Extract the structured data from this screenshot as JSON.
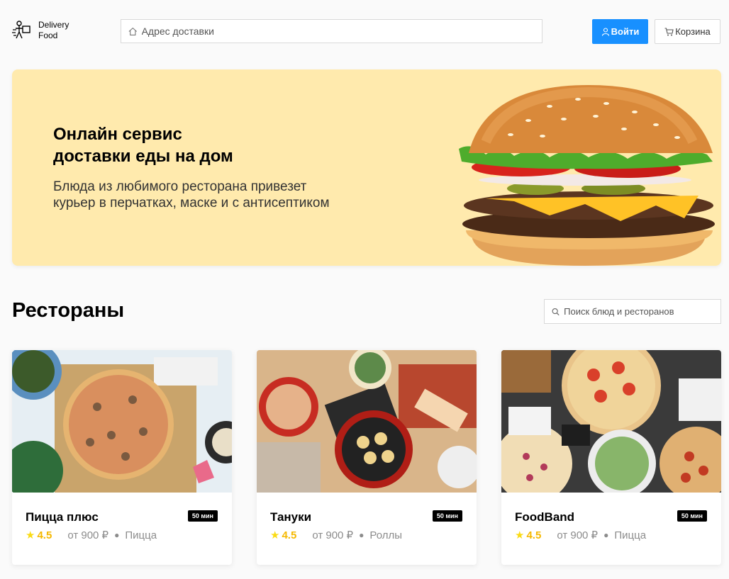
{
  "header": {
    "logo_line1": "Delivery",
    "logo_line2": "Food",
    "address_placeholder": "Адрес доставки",
    "login_label": "Войти",
    "cart_label": "Корзина",
    "accent_color": "#1890ff"
  },
  "promo": {
    "title": "Онлайн сервис\nдоставки еды на дом",
    "text": "Блюда из любимого ресторана привезет\nкурьер в перчатках, маске и с антисептиком",
    "background": "#ffeaad"
  },
  "restaurants": {
    "title": "Рестораны",
    "search_placeholder": "Поиск блюд и ресторанов",
    "items": [
      {
        "name": "Пицца плюс",
        "time": "50 мин",
        "rating": "4.5",
        "price": "от 900 ₽",
        "category": "Пицца"
      },
      {
        "name": "Тануки",
        "time": "50 мин",
        "rating": "4.5",
        "price": "от 900 ₽",
        "category": "Роллы"
      },
      {
        "name": "FoodBand",
        "time": "50 мин",
        "rating": "4.5",
        "price": "от 900 ₽",
        "category": "Пицца"
      }
    ]
  },
  "icons": {
    "logo": "delivery-person-icon",
    "address": "home-icon",
    "login": "user-icon",
    "cart": "cart-icon",
    "search": "search-icon",
    "rating": "star-icon"
  }
}
